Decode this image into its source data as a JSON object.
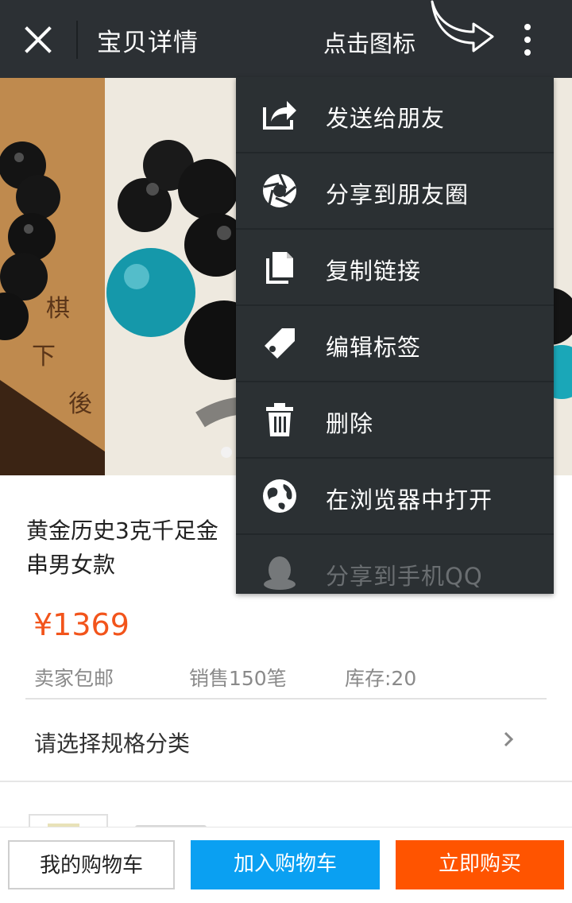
{
  "header": {
    "title": "宝贝详情",
    "hint": "点击图标"
  },
  "product": {
    "title": "黄金历史3克千足金",
    "title_line2": "串男女款",
    "price": "¥1369",
    "shipping": "卖家包邮",
    "sales": "销售150笔",
    "stock": "库存:20",
    "spec_label": "请选择规格分类"
  },
  "menu": {
    "items": [
      {
        "label": "发送给朋友",
        "icon": "share-arrow-icon"
      },
      {
        "label": "分享到朋友圈",
        "icon": "moments-aperture-icon"
      },
      {
        "label": "复制链接",
        "icon": "copy-icon"
      },
      {
        "label": "编辑标签",
        "icon": "tag-icon"
      },
      {
        "label": "删除",
        "icon": "trash-icon"
      },
      {
        "label": "在浏览器中打开",
        "icon": "globe-icon"
      },
      {
        "label": "分享到手机QQ",
        "icon": "qq-penguin-icon"
      }
    ]
  },
  "bottom_bar": {
    "cart": "我的购物车",
    "add_to_cart": "加入购物车",
    "buy_now": "立即购买"
  },
  "colors": {
    "header_bg": "#2c3034",
    "menu_bg": "#2b3033",
    "price": "#f2541b",
    "add_to_cart": "#0aa0f2",
    "buy_now": "#ff5400"
  }
}
